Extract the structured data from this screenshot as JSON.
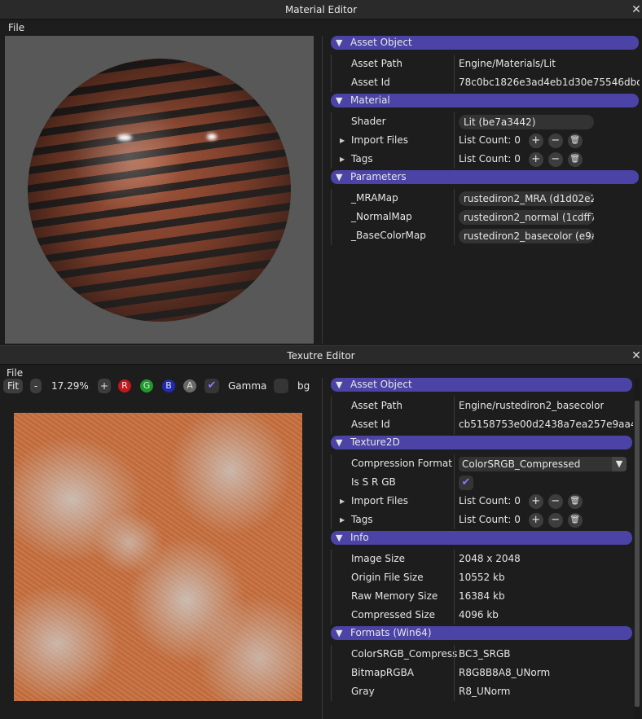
{
  "material_editor": {
    "title": "Material Editor",
    "close": "✕",
    "menu": {
      "file": "File"
    },
    "asset_object": {
      "header": "Asset Object",
      "asset_path_label": "Asset Path",
      "asset_path_value": "Engine/Materials/Lit",
      "asset_id_label": "Asset Id",
      "asset_id_value": "78c0bc1826e3ad4eb1d30e75546dbdb"
    },
    "material": {
      "header": "Material",
      "shader_label": "Shader",
      "shader_value": "Lit (be7a3442)",
      "import_files_label": "Import Files",
      "import_files_value": "List Count: 0",
      "tags_label": "Tags",
      "tags_value": "List Count: 0"
    },
    "parameters": {
      "header": "Parameters",
      "items": [
        {
          "label": "_MRAMap",
          "value": "rustediron2_MRA (d1d02e2f"
        },
        {
          "label": "_NormalMap",
          "value": "rustediron2_normal (1cdff7"
        },
        {
          "label": "_BaseColorMap",
          "value": "rustediron2_basecolor (e9a"
        }
      ]
    }
  },
  "texture_editor": {
    "title": "Texutre Editor",
    "close": "✕",
    "menu": {
      "file": "File"
    },
    "toolbar": {
      "fit": "Fit",
      "minus": "-",
      "zoom": "17.29%",
      "plus": "+",
      "r": "R",
      "g": "G",
      "b": "B",
      "a": "A",
      "gamma": "Gamma",
      "bg": "bg",
      "colors": {
        "r": "#c0181c",
        "g": "#1f9a2a",
        "b": "#1f2bb0",
        "a": "#6a6a6a"
      }
    },
    "asset_object": {
      "header": "Asset Object",
      "asset_path_label": "Asset Path",
      "asset_path_value": "Engine/rustediron2_basecolor",
      "asset_id_label": "Asset Id",
      "asset_id_value": "cb5158753e00d2438a7ea257e9aa44"
    },
    "texture2d": {
      "header": "Texture2D",
      "compression_label": "Compression Format",
      "compression_value": "ColorSRGB_Compressed",
      "srgb_label": "Is S R GB",
      "import_files_label": "Import Files",
      "import_files_value": "List Count: 0",
      "tags_label": "Tags",
      "tags_value": "List Count: 0"
    },
    "info": {
      "header": "Info",
      "items": [
        {
          "label": "Image Size",
          "value": "2048 x 2048"
        },
        {
          "label": "Origin File Size",
          "value": "10552 kb"
        },
        {
          "label": "Raw Memory Size",
          "value": "16384 kb"
        },
        {
          "label": "Compressed Size",
          "value": "4096 kb"
        }
      ]
    },
    "formats": {
      "header": "Formats (Win64)",
      "items": [
        {
          "label": "ColorSRGB_Compress",
          "value": "BC3_SRGB"
        },
        {
          "label": "BitmapRGBA",
          "value": "R8G8B8A8_UNorm"
        },
        {
          "label": "Gray",
          "value": "R8_UNorm"
        }
      ]
    }
  },
  "theme": {
    "accent": "#4b43a6",
    "check": "#8878ff"
  }
}
